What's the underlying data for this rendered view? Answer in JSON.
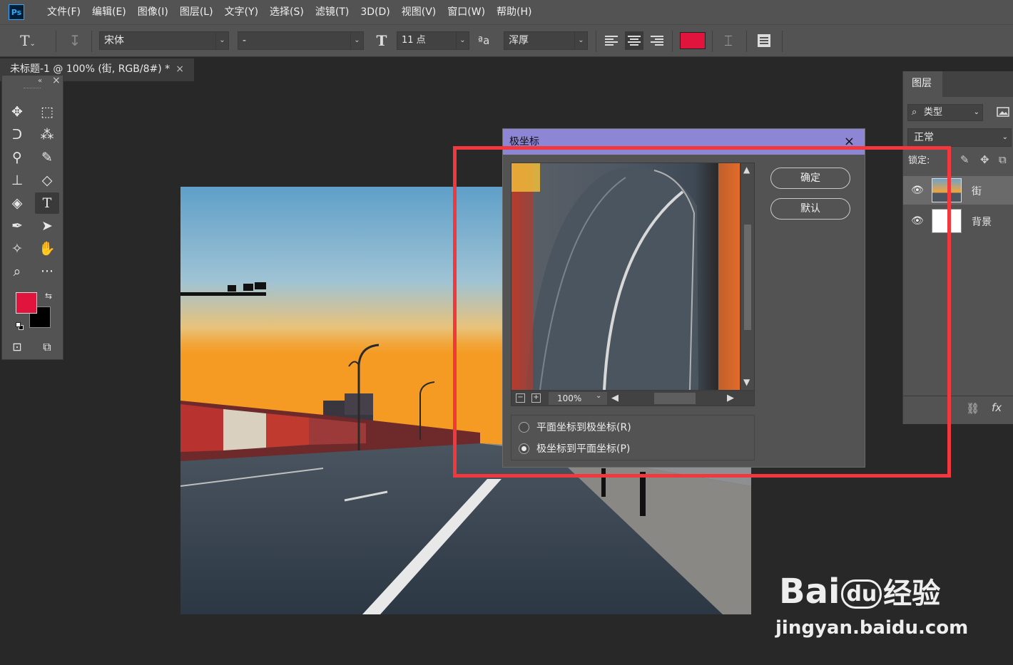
{
  "menubar": {
    "logo": "Ps",
    "items": [
      "文件(F)",
      "编辑(E)",
      "图像(I)",
      "图层(L)",
      "文字(Y)",
      "选择(S)",
      "滤镜(T)",
      "3D(D)",
      "视图(V)",
      "窗口(W)",
      "帮助(H)"
    ]
  },
  "options": {
    "font_family": "宋体",
    "font_style": "-",
    "font_size": "11 点",
    "aa_label": "ªa",
    "aa_mode": "浑厚",
    "text_color": "#e0143c"
  },
  "document": {
    "tab_title": "未标题-1 @ 100% (街, RGB/8#) *"
  },
  "tools": {
    "fg_color": "#e0143c",
    "bg_color": "#000000"
  },
  "layers": {
    "tab": "图层",
    "filter_label": "类型",
    "blend_mode": "正常",
    "lock_label": "锁定:",
    "items": [
      {
        "name": "街",
        "visible": true,
        "selected": true
      },
      {
        "name": "背景",
        "visible": true,
        "selected": false
      }
    ],
    "fx_label": "fx"
  },
  "dialog": {
    "title": "极坐标",
    "ok_label": "确定",
    "default_label": "默认",
    "zoom": "100%",
    "option_rect_to_polar": "平面坐标到极坐标(R)",
    "option_polar_to_rect": "极坐标到平面坐标(P)",
    "selected_option": "polar_to_rect"
  },
  "watermark": {
    "brand_left": "Bai",
    "brand_mid": "du",
    "brand_right": "经验",
    "url": "jingyan.baidu.com"
  },
  "colors": {
    "highlight": "#f2383c",
    "dialog_title_bar": "#8d86d4",
    "panel": "#535353"
  }
}
